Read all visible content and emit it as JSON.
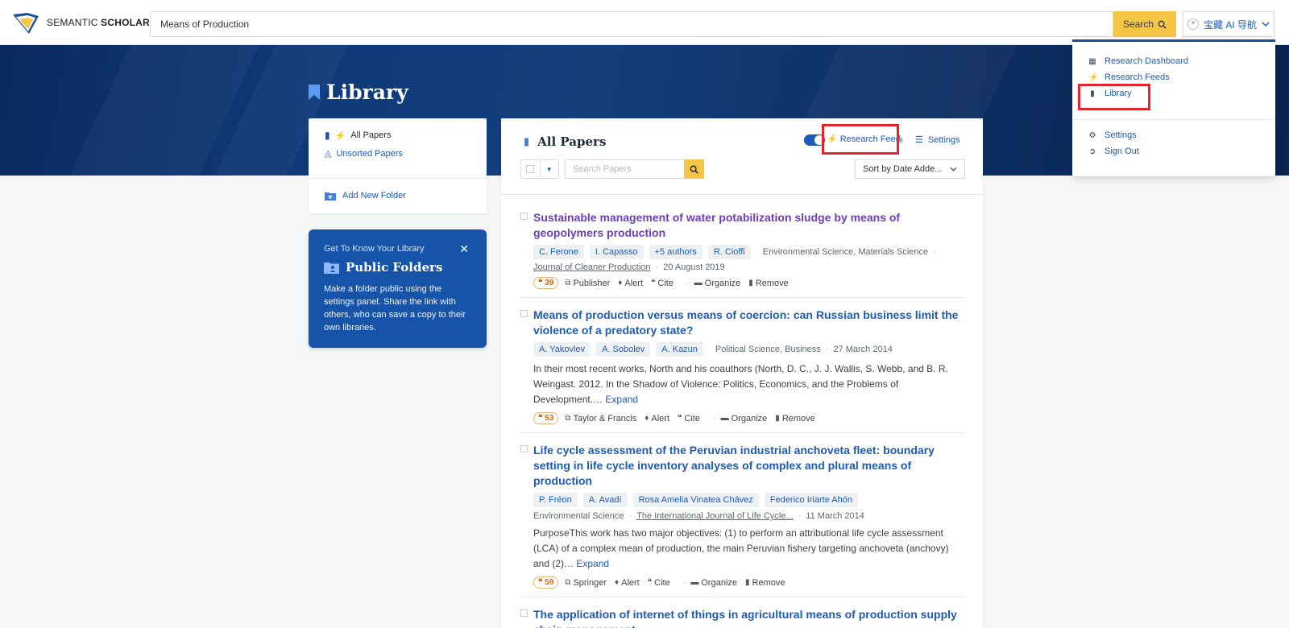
{
  "header": {
    "brand_light": "SEMANTIC ",
    "brand_bold": "SCHOLAR",
    "search_value": "Means of Production",
    "search_label": "Search",
    "user_label": "宝藏 AI 导航"
  },
  "page": {
    "title": "Library"
  },
  "sidebar": {
    "all_papers": "All Papers",
    "unsorted": "Unsorted Papers",
    "add_folder": "Add New Folder"
  },
  "promo": {
    "kicker": "Get To Know Your Library",
    "title": "Public Folders",
    "body": "Make a folder public using the settings panel. Share the link with others, who can save a copy to their own libraries."
  },
  "main": {
    "title": "All Papers",
    "research_feed": "Research Feed",
    "settings": "Settings",
    "search_placeholder": "Search Papers",
    "sort_label": "Sort by Date Adde..."
  },
  "papers": [
    {
      "title": "Sustainable management of water potabilization sludge by means of geopolymers production",
      "authors": [
        "C. Ferone",
        "I. Capasso",
        "+5 authors",
        "R. Cioffi"
      ],
      "fields": "Environmental Science, Materials Science",
      "venue": "Journal of Cleaner Production",
      "date": "20 August 2019",
      "citations": "39",
      "source": "Publisher",
      "abstract": "",
      "expand": ""
    },
    {
      "title": "Means of production versus means of coercion: can Russian business limit the violence of a predatory state?",
      "authors": [
        "A. Yakovlev",
        "A. Sobolev",
        "A. Kazun"
      ],
      "fields": "Political Science, Business",
      "venue": "",
      "date": "27 March 2014",
      "citations": "53",
      "source": "Taylor & Francis",
      "abstract": "In their most recent works, North and his coauthors (North, D. C., J. J. Wallis, S. Webb, and B. R. Weingast. 2012. In the Shadow of Violence: Politics, Economics, and the Problems of Development.…",
      "expand": "Expand"
    },
    {
      "title": "Life cycle assessment of the Peruvian industrial anchoveta fleet: boundary setting in life cycle inventory analyses of complex and plural means of production",
      "authors": [
        "P. Fréon",
        "A. Avadí",
        "Rosa Amelia Vinatea Chávez",
        "Federico Iriarte Ahón"
      ],
      "fields": "Environmental Science",
      "venue": "The International Journal of Life Cycle...",
      "date": "11 March 2014",
      "citations": "59",
      "source": "Springer",
      "abstract": "PurposeThis work has two major objectives: (1) to perform an attributional life cycle assessment (LCA) of a complex mean of production, the main Peruvian fishery targeting anchoveta (anchovy) and (2)…",
      "expand": "Expand"
    },
    {
      "title": "The application of internet of things in agricultural means of production supply chain management."
    }
  ],
  "actions": {
    "alert": "Alert",
    "cite": "Cite",
    "organize": "Organize",
    "remove": "Remove"
  },
  "menu": {
    "dashboard": "Research Dashboard",
    "feeds": "Research Feeds",
    "library": "Library",
    "settings": "Settings",
    "signout": "Sign Out"
  },
  "colors": {
    "accent": "#1d5bb5",
    "brand_yellow": "#f5c645",
    "highlight": "#e8222d",
    "hero": "#0f3a7a"
  }
}
